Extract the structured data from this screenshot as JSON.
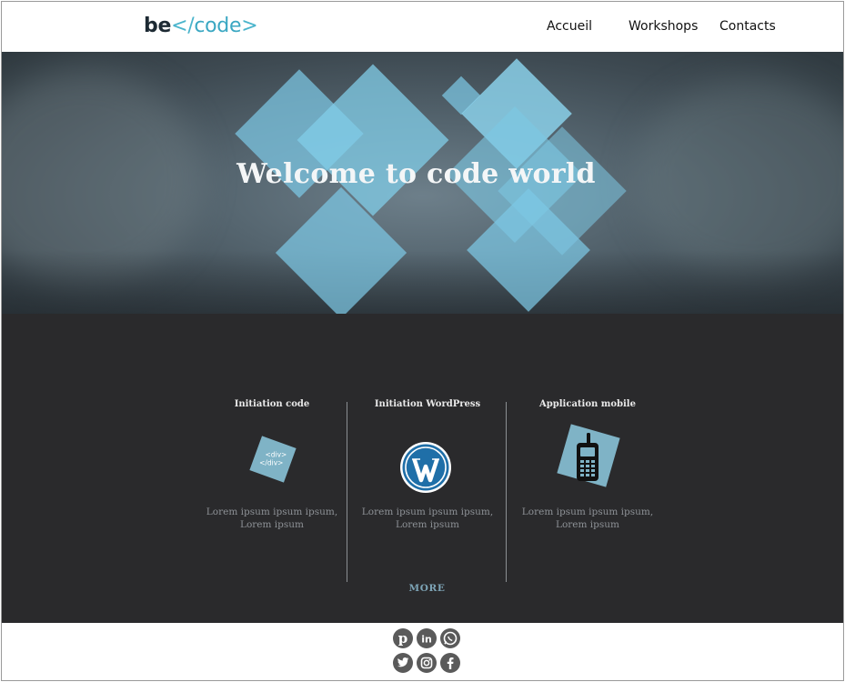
{
  "header": {
    "logo": {
      "be": "be",
      "tag_open": "</",
      "code": "code",
      "tag_close": ">"
    },
    "nav": [
      {
        "label": "Accueil"
      },
      {
        "label": "Workshops"
      },
      {
        "label": "Contacts"
      }
    ]
  },
  "hero": {
    "title": "Welcome to code world"
  },
  "services": {
    "columns": [
      {
        "title": "Initiation code",
        "icon": "code-square-icon",
        "icon_lines": [
          "<div>",
          "</div>"
        ],
        "text": "Lorem ipsum ipsum ipsum, Lorem ipsum"
      },
      {
        "title": "Initiation WordPress",
        "icon": "wordpress-icon",
        "text": "Lorem ipsum ipsum ipsum, Lorem ipsum"
      },
      {
        "title": "Application mobile",
        "icon": "mobile-phone-icon",
        "text": "Lorem ipsum ipsum ipsum, Lorem ipsum"
      }
    ],
    "more_label": "MORE"
  },
  "footer": {
    "social": [
      "pinterest-icon",
      "linkedin-icon",
      "whatsapp-icon",
      "twitter-icon",
      "instagram-icon",
      "facebook-icon"
    ]
  },
  "colors": {
    "accent": "#7fb3c6",
    "logo_code": "#3aa7c2",
    "dark_section": "#2a2a2c",
    "diamond": "#7dc8e4",
    "icon_gray": "#5a5a5a"
  }
}
